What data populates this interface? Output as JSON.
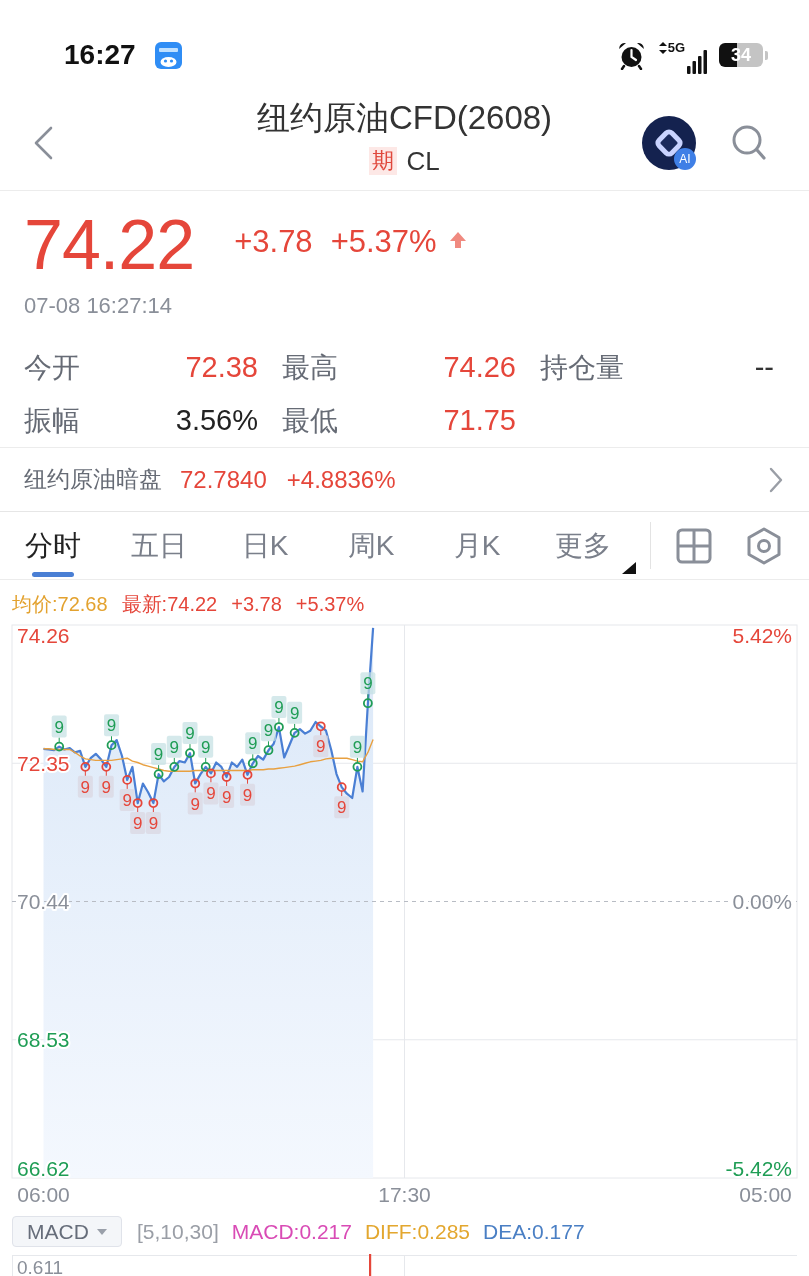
{
  "status_bar": {
    "time": "16:27",
    "network": "5G",
    "battery": "34"
  },
  "header": {
    "title": "纽约原油CFD(2608)",
    "tag": "期",
    "code": "CL",
    "ai_badge": "AI"
  },
  "quote": {
    "price": "74.22",
    "change": "+3.78",
    "change_pct": "+5.37%",
    "up": true,
    "timestamp": "07-08 16:27:14"
  },
  "stats": [
    {
      "label": "今开",
      "value": "72.38",
      "color": "#e5463a"
    },
    {
      "label": "最高",
      "value": "74.26",
      "color": "#e5463a"
    },
    {
      "label": "持仓量",
      "value": "--",
      "color": "#333333"
    },
    {
      "label": "振幅",
      "value": "3.56%",
      "color": "#222222"
    },
    {
      "label": "最低",
      "value": "71.75",
      "color": "#e5463a"
    }
  ],
  "dark_pool": {
    "label": "纽约原油暗盘",
    "price": "72.7840",
    "change_pct": "+4.8836%",
    "up": true
  },
  "chart_tabs": [
    {
      "label": "分时",
      "selected": true,
      "kind": "period"
    },
    {
      "label": "五日",
      "selected": false,
      "kind": "period"
    },
    {
      "label": "日K",
      "selected": false,
      "kind": "period"
    },
    {
      "label": "周K",
      "selected": false,
      "kind": "period"
    },
    {
      "label": "月K",
      "selected": false,
      "kind": "period"
    },
    {
      "label": "更多",
      "selected": false,
      "kind": "menu"
    }
  ],
  "chart": {
    "legend": [
      {
        "label": "均价:72.68",
        "color": "#e3a22f"
      },
      {
        "label": "最新:74.22",
        "color": "#e5463a"
      },
      {
        "label": "+3.78",
        "color": "#e5463a"
      },
      {
        "label": "+5.37%",
        "color": "#e5463a"
      }
    ],
    "right_axis": [
      {
        "label": "5.42%",
        "color": "#e5463a"
      },
      {
        "label": "0.00%",
        "color": "#8a8f99"
      },
      {
        "label": "-5.42%",
        "color": "#1f9d55"
      }
    ],
    "chart_data": {
      "type": "line",
      "categories": [
        "06:00",
        null,
        null,
        null,
        null,
        null,
        null,
        null,
        null,
        null,
        null,
        null,
        null,
        null,
        null,
        null,
        null,
        null,
        null,
        null,
        null,
        null,
        null,
        null,
        null,
        null,
        null,
        null,
        null,
        null,
        null,
        null,
        null,
        null,
        null,
        null,
        null,
        null,
        null,
        null,
        null,
        null,
        null,
        null,
        null,
        null,
        null,
        null,
        null,
        null,
        null,
        null,
        null,
        null,
        null,
        null,
        null,
        null,
        null,
        null,
        null,
        null,
        null,
        null,
        null,
        null,
        null,
        null,
        null,
        "17:30",
        null,
        null,
        null,
        null,
        null,
        null,
        null,
        null,
        null,
        null,
        null,
        null,
        null,
        null,
        null,
        null,
        null,
        null,
        null,
        null,
        null,
        null,
        null,
        null,
        null,
        null,
        null,
        null,
        null,
        null,
        null,
        null,
        null,
        null,
        null,
        null,
        null,
        null,
        null,
        null,
        null,
        null,
        null,
        null,
        null,
        null,
        null,
        null,
        null,
        null,
        null,
        null,
        null,
        null,
        null,
        null,
        null,
        null,
        null,
        null,
        null,
        null,
        null,
        null,
        null,
        null,
        null,
        null,
        "05:00"
      ],
      "series": [
        {
          "color": "#4a7fd4",
          "values": [
            72.55,
            72.54,
            72.53,
            72.58,
            72.54,
            72.56,
            72.5,
            72.52,
            72.3,
            72.42,
            72.48,
            72.4,
            72.3,
            72.6,
            72.67,
            72.45,
            72.12,
            72.3,
            71.8,
            72.07,
            71.95,
            71.8,
            72.2,
            72.1,
            72.16,
            72.3,
            72.38,
            72.36,
            72.49,
            72.07,
            72.2,
            72.3,
            72.21,
            72.36,
            72.3,
            72.16,
            72.36,
            72.3,
            72.4,
            72.19,
            72.35,
            72.45,
            72.4,
            72.53,
            72.62,
            72.85,
            72.43,
            72.6,
            72.77,
            72.82,
            72.76,
            72.8,
            72.92,
            72.86,
            72.8,
            72.53,
            72.2,
            72.02,
            71.93,
            71.87,
            72.3,
            71.96,
            73.18,
            74.22,
            null,
            null,
            null,
            null,
            null,
            null,
            null,
            null,
            null,
            null,
            null,
            null,
            null,
            null,
            null,
            null,
            null,
            null,
            null,
            null,
            null,
            null,
            null,
            null,
            null,
            null,
            null,
            null,
            null,
            null,
            null,
            null,
            null,
            null,
            null,
            null,
            null,
            null,
            null,
            null,
            null,
            null,
            null,
            null,
            null,
            null,
            null,
            null,
            null,
            null,
            null,
            null,
            null,
            null,
            null,
            null,
            null,
            null,
            null,
            null,
            null,
            null,
            null,
            null,
            null,
            null,
            null,
            null,
            null,
            null,
            null,
            null,
            null,
            null,
            null
          ]
        },
        {
          "color": "#e8a040",
          "values": [
            72.55,
            72.55,
            72.54,
            72.54,
            72.54,
            72.54,
            72.5,
            72.45,
            72.41,
            72.4,
            72.39,
            72.39,
            72.39,
            72.39,
            72.4,
            72.41,
            72.42,
            72.38,
            72.36,
            72.33,
            72.31,
            72.29,
            72.27,
            72.25,
            72.24,
            72.24,
            72.24,
            72.24,
            72.24,
            72.25,
            72.25,
            72.25,
            72.25,
            72.25,
            72.25,
            72.25,
            72.25,
            72.25,
            72.25,
            72.25,
            72.26,
            72.26,
            72.26,
            72.27,
            72.27,
            72.28,
            72.29,
            72.3,
            72.31,
            72.33,
            72.35,
            72.37,
            72.38,
            72.39,
            72.41,
            72.42,
            72.42,
            72.42,
            72.42,
            72.4,
            72.38,
            72.37,
            72.5,
            72.68,
            null,
            null,
            null,
            null,
            null,
            null,
            null,
            null,
            null,
            null,
            null,
            null,
            null,
            null,
            null,
            null,
            null,
            null,
            null,
            null,
            null,
            null,
            null,
            null,
            null,
            null,
            null,
            null,
            null,
            null,
            null,
            null,
            null,
            null,
            null,
            null,
            null,
            null,
            null,
            null,
            null,
            null,
            null,
            null,
            null,
            null,
            null,
            null,
            null,
            null,
            null,
            null,
            null,
            null,
            null,
            null,
            null,
            null,
            null,
            null,
            null,
            null,
            null,
            null,
            null,
            null,
            null,
            null,
            null,
            null,
            null,
            null,
            null,
            null,
            null
          ]
        },
        {
          "color": "#1f9d55",
          "marker": "circle",
          "values": [
            null,
            null,
            null,
            72.58,
            null,
            null,
            null,
            null,
            null,
            null,
            null,
            null,
            null,
            72.6,
            null,
            null,
            null,
            null,
            null,
            null,
            null,
            null,
            72.2,
            null,
            null,
            72.3,
            null,
            null,
            72.49,
            null,
            null,
            72.3,
            null,
            null,
            null,
            null,
            null,
            null,
            null,
            null,
            72.35,
            null,
            null,
            72.53,
            null,
            72.85,
            null,
            null,
            72.77,
            null,
            null,
            null,
            null,
            null,
            null,
            null,
            null,
            null,
            null,
            null,
            72.3,
            null,
            73.18,
            null,
            null,
            null,
            null,
            null,
            null,
            null,
            null,
            null,
            null,
            null,
            null,
            null,
            null,
            null,
            null,
            null,
            null,
            null,
            null,
            null,
            null,
            null,
            null,
            null,
            null,
            null,
            null,
            null,
            null,
            null,
            null,
            null,
            null,
            null,
            null,
            null,
            null,
            null,
            null,
            null,
            null,
            null,
            null,
            null,
            null,
            null,
            null,
            null,
            null,
            null,
            null,
            null,
            null,
            null,
            null,
            null,
            null,
            null,
            null,
            null,
            null,
            null,
            null,
            null,
            null,
            null,
            null,
            null,
            null,
            null,
            null,
            null,
            null,
            null,
            null
          ]
        },
        {
          "color": "#e5463a",
          "marker": "circle",
          "values": [
            null,
            null,
            null,
            null,
            null,
            null,
            null,
            null,
            72.3,
            null,
            null,
            null,
            72.3,
            null,
            null,
            null,
            72.12,
            null,
            71.8,
            null,
            null,
            71.8,
            null,
            null,
            null,
            null,
            null,
            null,
            null,
            72.07,
            null,
            null,
            72.21,
            null,
            null,
            72.16,
            null,
            null,
            null,
            72.19,
            null,
            null,
            null,
            null,
            null,
            null,
            null,
            null,
            null,
            null,
            null,
            null,
            null,
            72.86,
            null,
            null,
            null,
            72.02,
            null,
            null,
            null,
            null,
            null,
            null,
            null,
            null,
            null,
            null,
            null,
            null,
            null,
            null,
            null,
            null,
            null,
            null,
            null,
            null,
            null,
            null,
            null,
            null,
            null,
            null,
            null,
            null,
            null,
            null,
            null,
            null,
            null,
            null,
            null,
            null,
            null,
            null,
            null,
            null,
            null,
            null,
            null,
            null,
            null,
            null,
            null,
            null,
            null,
            null,
            null,
            null,
            null,
            null,
            null,
            null,
            null,
            null,
            null,
            null,
            null,
            null,
            null,
            null,
            null,
            null,
            null,
            null,
            null,
            null,
            null,
            null,
            null,
            null,
            null,
            null,
            null,
            null,
            null,
            null,
            null
          ]
        }
      ],
      "ylim": [
        66.62,
        74.26
      ],
      "yticks": [
        74.26,
        72.35,
        70.44,
        68.53,
        66.62
      ],
      "ref_lines": [
        {
          "axis": "y",
          "value": 70.44
        }
      ],
      "annotations": [
        "9",
        "9",
        "9",
        "9",
        "9",
        "9",
        "9",
        "9",
        "9",
        "9",
        "9",
        "9",
        "9",
        "9",
        "9",
        "9",
        "9",
        "9",
        "9",
        "9",
        "9",
        "9",
        "9"
      ]
    }
  },
  "indicator": {
    "name": "MACD",
    "params": "[5,10,30]",
    "values": [
      {
        "label": "MACD:0.217",
        "color": "#d94bb5"
      },
      {
        "label": "DIFF:0.285",
        "color": "#e3a72f"
      },
      {
        "label": "DEA:0.177",
        "color": "#4a7fc4"
      }
    ],
    "top_label": "0.611"
  }
}
